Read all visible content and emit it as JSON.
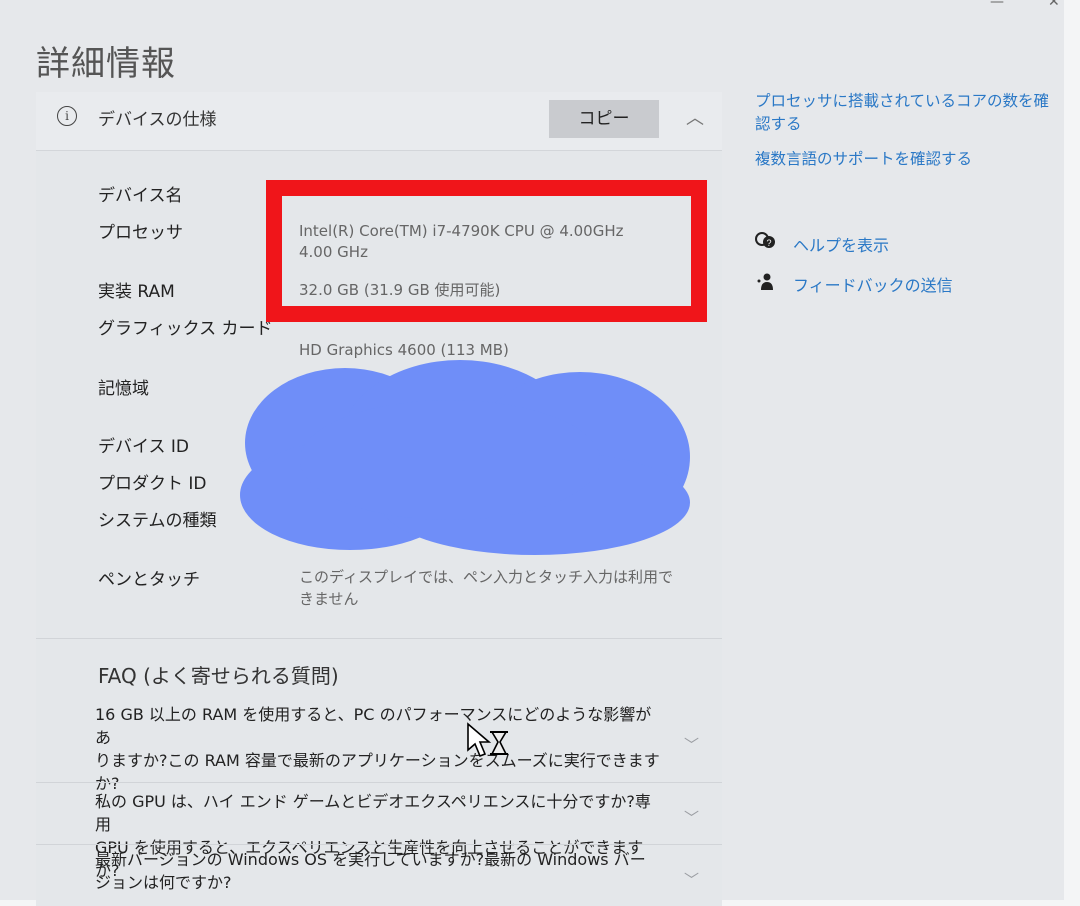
{
  "window": {
    "title": "詳細情報",
    "minimize_glyph": "—",
    "close_glyph": "✕"
  },
  "device_spec": {
    "header": "デバイスの仕様",
    "info_icon_glyph": "i",
    "copy_label": "コピー",
    "collapse_glyph": "︿",
    "rows": [
      {
        "label": "デバイス名",
        "value": ""
      },
      {
        "label": "プロセッサ",
        "value_line1": "Intel(R)  Core(TM)  i7-4790K  CPU  @  4.00GHz",
        "value_line2": "4.00 GHz"
      },
      {
        "label": "実装 RAM",
        "value": "32.0 GB (31.9 GB 使用可能)"
      },
      {
        "label": "グラフィックス カード",
        "value": "HD Graphics 4600 (113 MB)"
      },
      {
        "label": "記憶域",
        "value": ""
      },
      {
        "label": "デバイス ID",
        "value": ""
      },
      {
        "label": "プロダクト ID",
        "value": ""
      },
      {
        "label": "システムの種類",
        "value": ""
      },
      {
        "label": "ペンとタッチ",
        "value_line1": "このディスプレイでは、ペン入力とタッチ入力は利用で",
        "value_line2": "きません"
      }
    ]
  },
  "faq": {
    "heading": "FAQ (よく寄せられる質問)",
    "chevron_glyph": "﹀",
    "items": [
      {
        "line1": "16 GB 以上の RAM を使用すると、PC のパフォーマンスにどのような影響があ",
        "line2": "りますか?この RAM 容量で最新のアプリケーションをスムーズに実行できます",
        "line3": "か?"
      },
      {
        "line1": "私の GPU は、ハイ エンド ゲームとビデオエクスペリエンスに十分ですか?専用",
        "line2": "GPU を使用すると、エクスペリエンスと生産性を向上させることができますか?"
      },
      {
        "line1": "最新バージョンの Windows OS を実行していますか?最新の Windows バー",
        "line2": "ジョンは何ですか?"
      }
    ]
  },
  "sidebar": {
    "link1_line1": "プロセッサに搭載されているコアの数を確",
    "link1_line2": "認する",
    "link2": "複数言語のサポートを確認する",
    "help_label": "ヘルプを表示",
    "feedback_label": "フィードバックの送信"
  },
  "colors": {
    "link": "#2a78c6",
    "highlight_box": "#f0151a",
    "redaction": "#6f8ef8"
  }
}
